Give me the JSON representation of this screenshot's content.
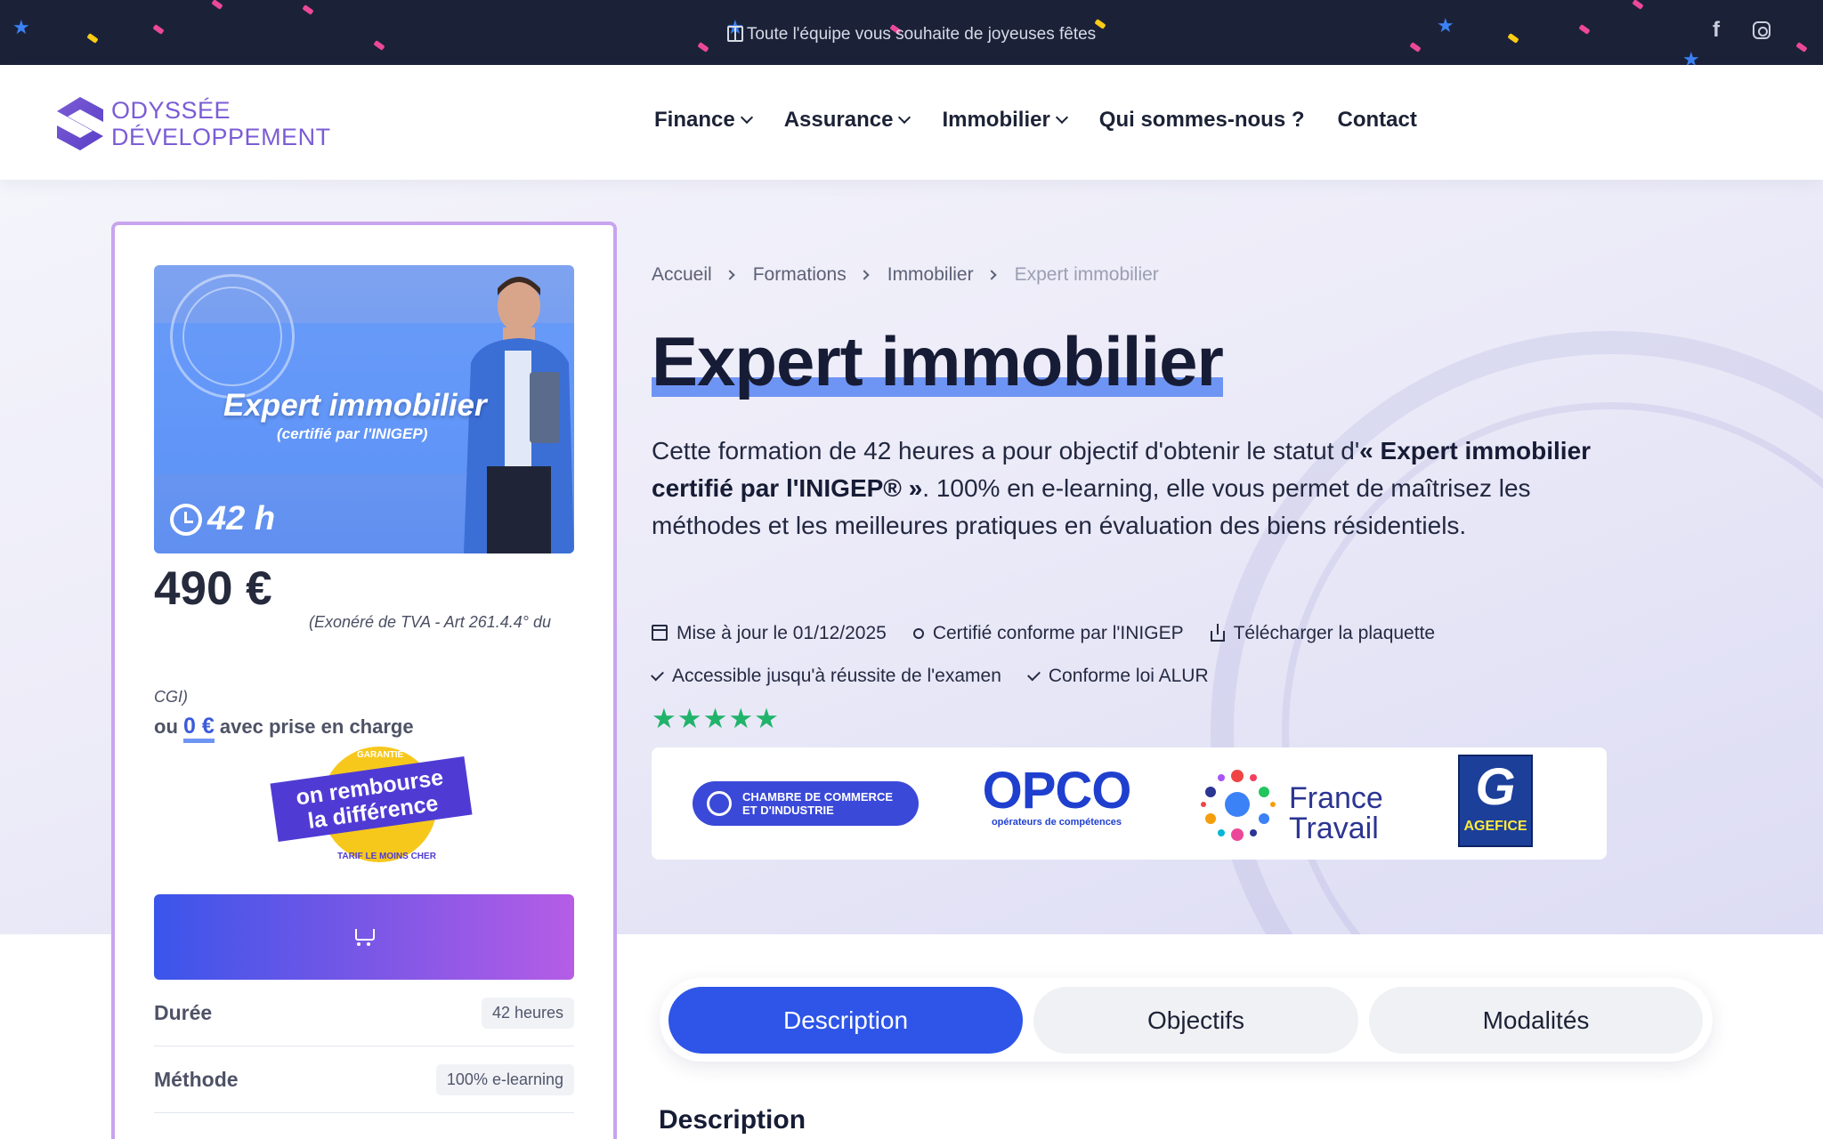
{
  "topbar": {
    "message": "Toute l'équipe vous souhaite de joyeuses fêtes",
    "social": [
      "facebook-icon",
      "instagram-icon"
    ]
  },
  "header": {
    "logo_line1": "ODYSSÉE",
    "logo_line2": "DÉVELOPPEMENT",
    "nav": [
      "Finance",
      "Assurance",
      "Immobilier",
      "Qui sommes-nous ?",
      "Contact"
    ]
  },
  "card": {
    "promo_title": "Expert immobilier",
    "promo_subtitle": "(certifié par l'INIGEP)",
    "promo_duration": "42 h",
    "price": "490 €",
    "price_note": "(Exonéré de TVA - Art 261.4.4° du CGI)",
    "funding_prefix": "ou",
    "funding_amount": "0 €",
    "funding_suffix": "avec prise en charge",
    "badge_top": "GARANTIE",
    "badge_ribbon_1": "on rembourse",
    "badge_ribbon_2": "la différence",
    "badge_bottom": "TARIF LE MOINS CHER",
    "specs": [
      {
        "key": "Durée",
        "value": "42 heures"
      },
      {
        "key": "Méthode",
        "value": "100% e-learning"
      }
    ]
  },
  "breadcrumb": [
    "Accueil",
    "Formations",
    "Immobilier",
    "Expert immobilier"
  ],
  "title": "Expert immobilier",
  "intro": {
    "part1": "Cette formation de 42 heures a pour objectif d'obtenir le statut d'",
    "bold": "« Expert immobilier certifié par l'INIGEP® »",
    "part2": ". 100% en e-learning, elle vous permet de maîtrisez les méthodes et les meilleures pratiques en évaluation des biens résidentiels."
  },
  "meta_row1": [
    "Mise à jour le 01/12/2025",
    "Certifié conforme par l'INIGEP",
    "Télécharger la plaquette"
  ],
  "meta_row2": [
    "Accessible jusqu'à réussite de l'examen",
    "Conforme loi ALUR"
  ],
  "rating": "★★★★★",
  "partners": {
    "cci_line1": "CHAMBRE DE COMMERCE",
    "cci_line2": "ET D'INDUSTRIE",
    "opco_big": "OPCO",
    "opco_small": "opérateurs de compétences",
    "ft_line1": "France",
    "ft_line2": "Travail",
    "agefice": "AGEFICE"
  },
  "tabs": [
    "Description",
    "Objectifs",
    "Modalités"
  ],
  "section_title": "Description",
  "colors": {
    "accent": "#2e55e8",
    "card_border": "#c8a4ee",
    "stars": "#21b36b",
    "topbar": "#1b2238"
  }
}
